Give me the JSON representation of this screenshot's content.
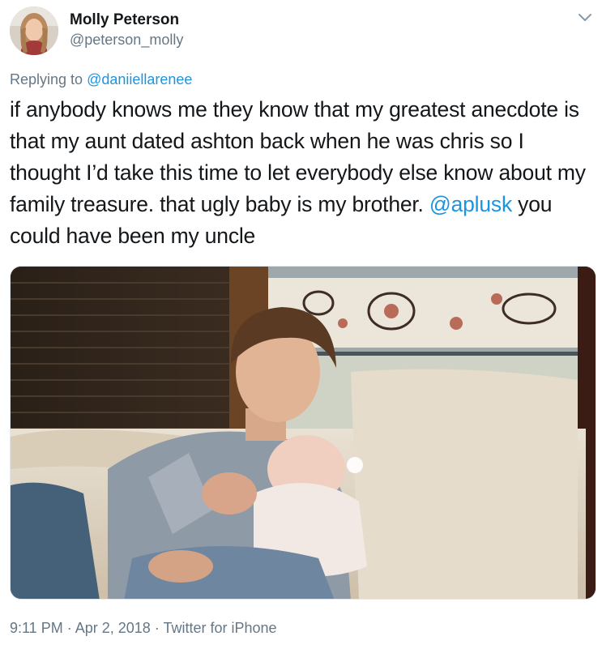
{
  "author": {
    "display_name": "Molly Peterson",
    "handle": "@peterson_molly",
    "avatar_icon": "profile-photo"
  },
  "tweet": {
    "reply_prefix": "Replying to ",
    "reply_to": "@daniiellarenee",
    "text_part1": "if anybody knows me they know that my greatest anecdote is that my aunt dated ashton back when he was chris so I thought I’d take this time to let everybody else know about my family treasure. that ugly baby is my brother. ",
    "mention": "@aplusk",
    "text_part2": " you could have been my uncle",
    "media_icon": "photo-attachment"
  },
  "footer": {
    "time": "9:11 PM",
    "separator": " · ",
    "date": "Apr 2, 2018",
    "source": "Twitter for iPhone"
  },
  "icons": {
    "menu": "chevron-down-icon"
  },
  "colors": {
    "link": "#1b95e0",
    "secondary_text": "#657786",
    "primary_text": "#14171a"
  }
}
